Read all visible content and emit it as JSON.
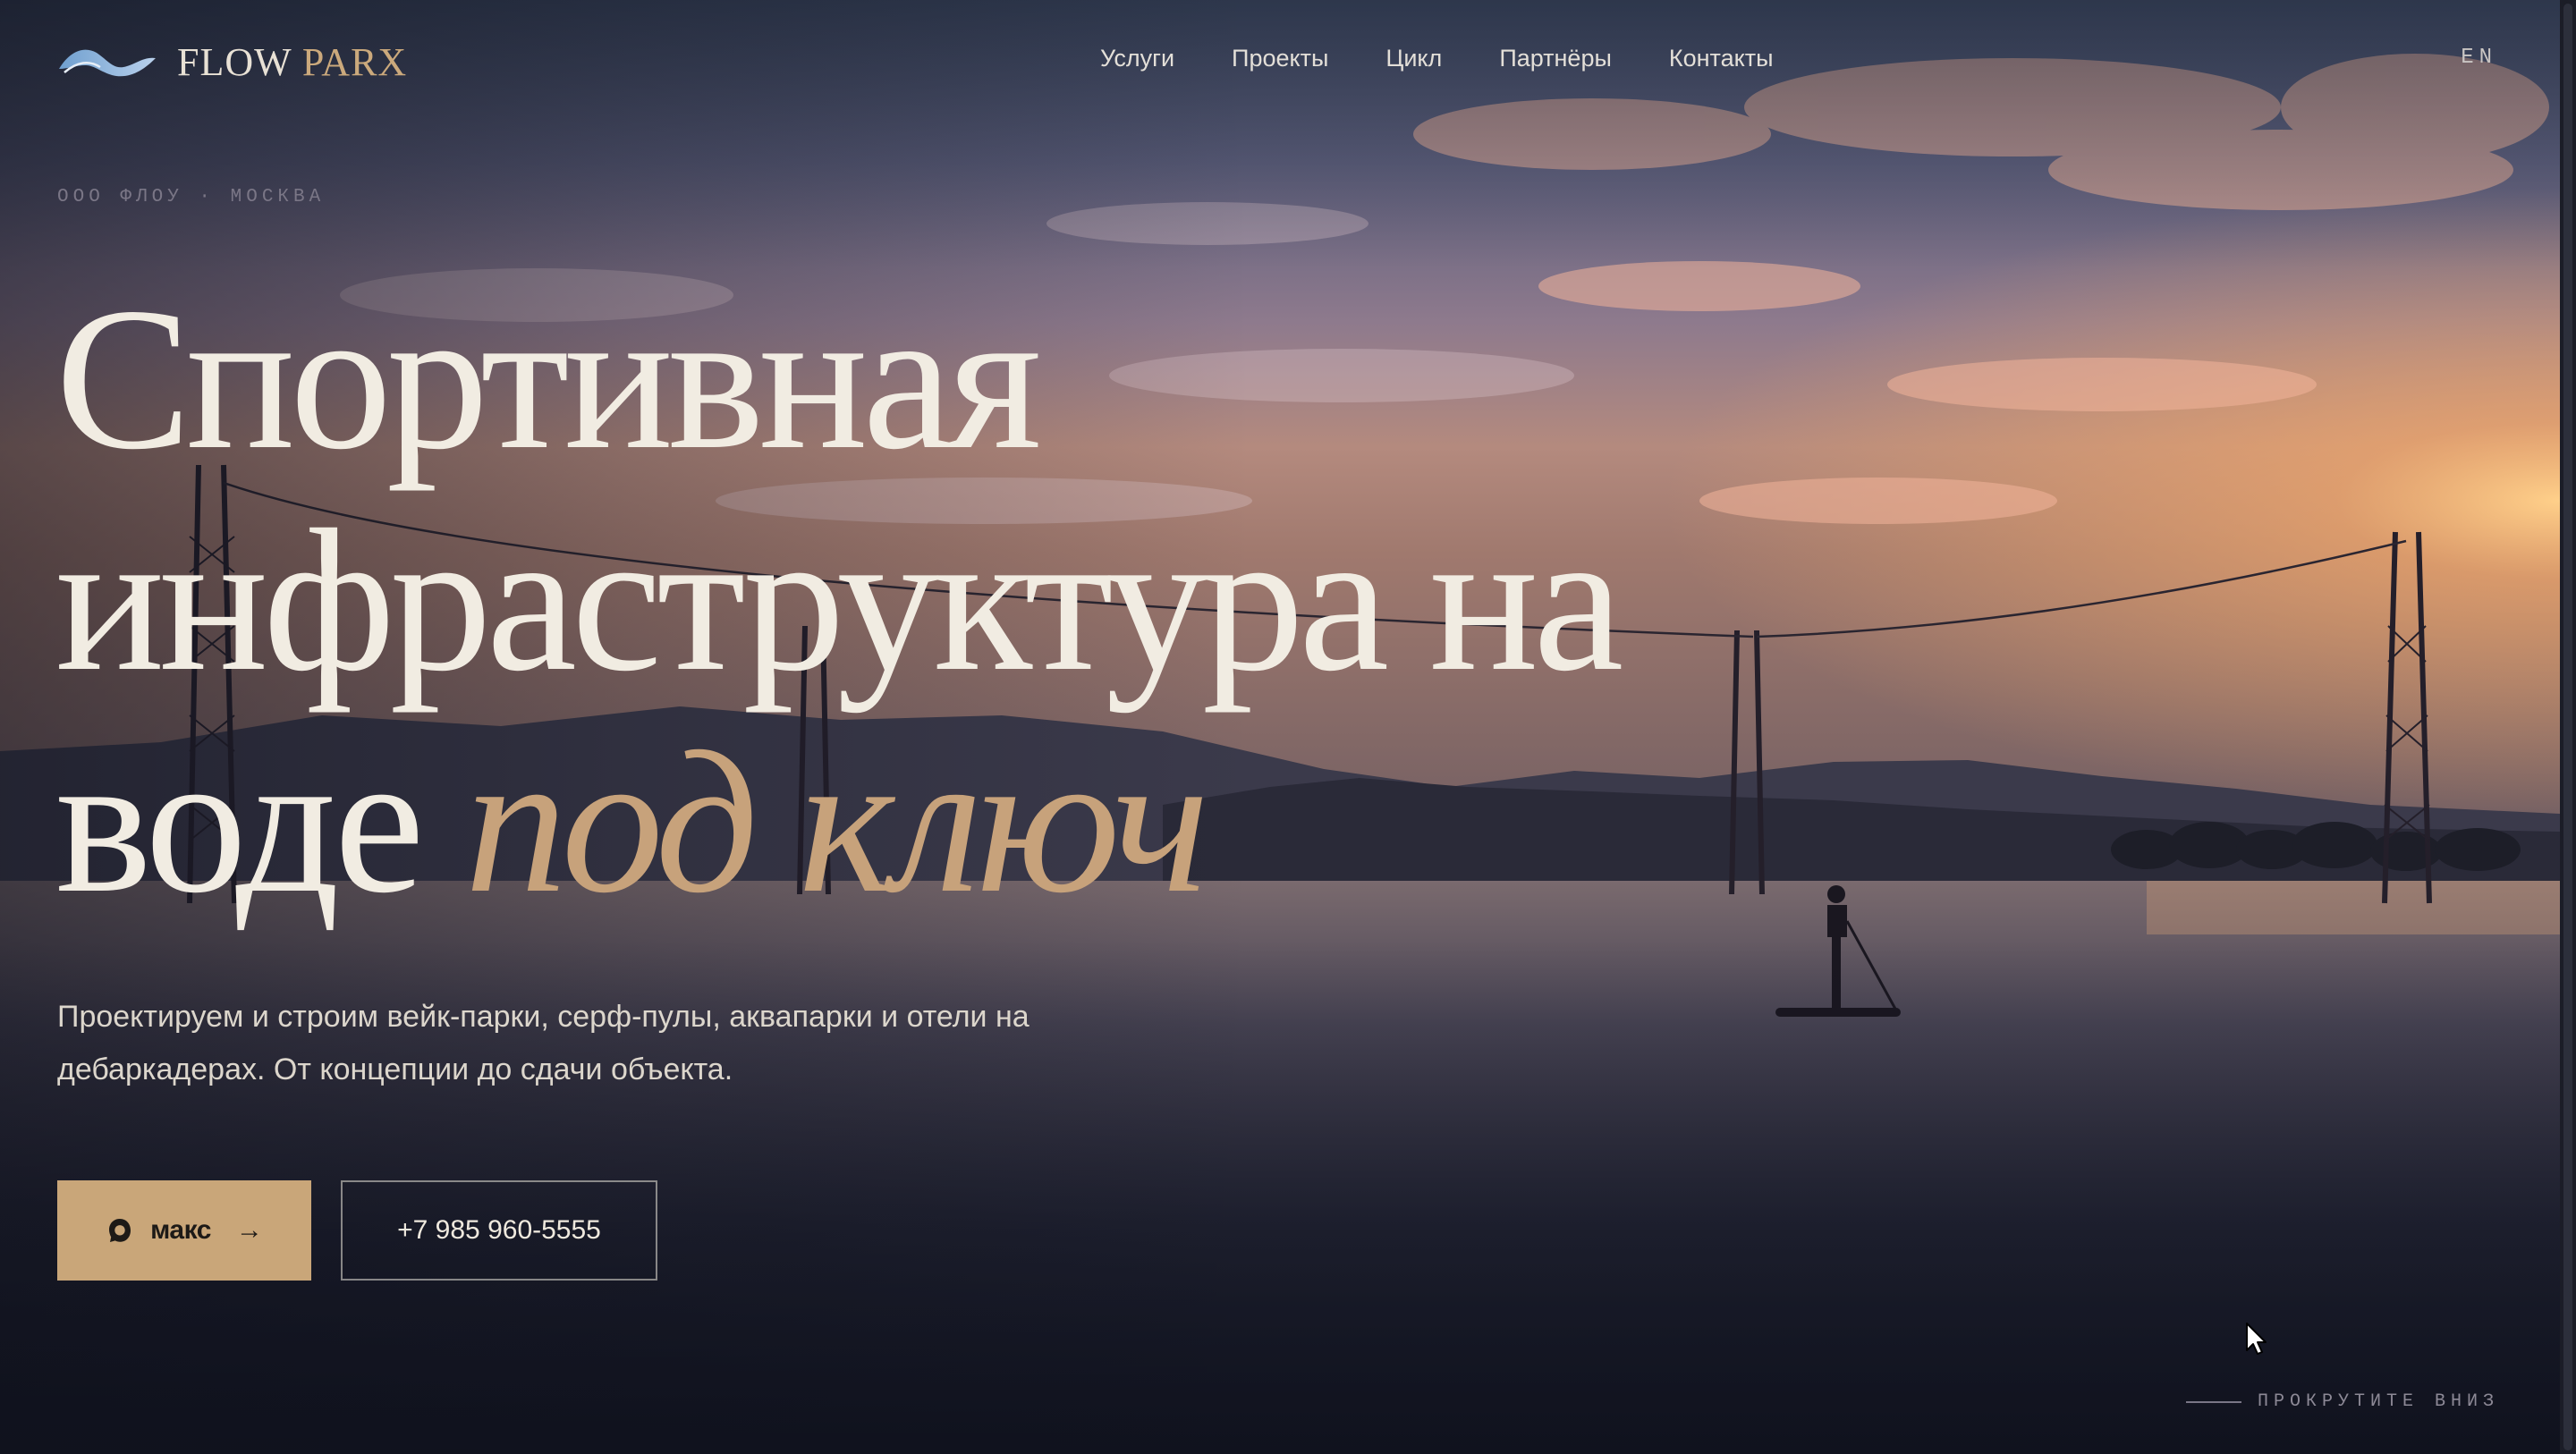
{
  "brand": {
    "name_part1": "FLOW",
    "name_part2": "PARX"
  },
  "nav": {
    "items": [
      {
        "label": "Услуги"
      },
      {
        "label": "Проекты"
      },
      {
        "label": "Цикл"
      },
      {
        "label": "Партнёры"
      },
      {
        "label": "Контакты"
      }
    ],
    "language_toggle": "EN"
  },
  "hero": {
    "eyebrow": "ООО ФЛОУ · МОСКВА",
    "headline_line1": "Спортивная",
    "headline_line2": "инфраструктура на",
    "headline_line3_plain": "воде",
    "headline_line3_accent": "под ключ",
    "lead_line1": "Проектируем и строим вейк-парки, серф-пулы, аквапарки и отели на",
    "lead_line2": "дебаркадерах. От концепции до сдачи объекта.",
    "primary_cta": {
      "label": "макс",
      "arrow": "→",
      "icon": "max-messenger-icon"
    },
    "phone_cta": "+7 985 960-5555",
    "scroll_hint": "ПРОКРУТИТЕ ВНИЗ"
  },
  "colors": {
    "accent": "#c9a679",
    "headline": "#f1ece2",
    "background_dark": "#141726"
  },
  "background": {
    "description_icon": "sunset-lake-wakepark-photo"
  }
}
